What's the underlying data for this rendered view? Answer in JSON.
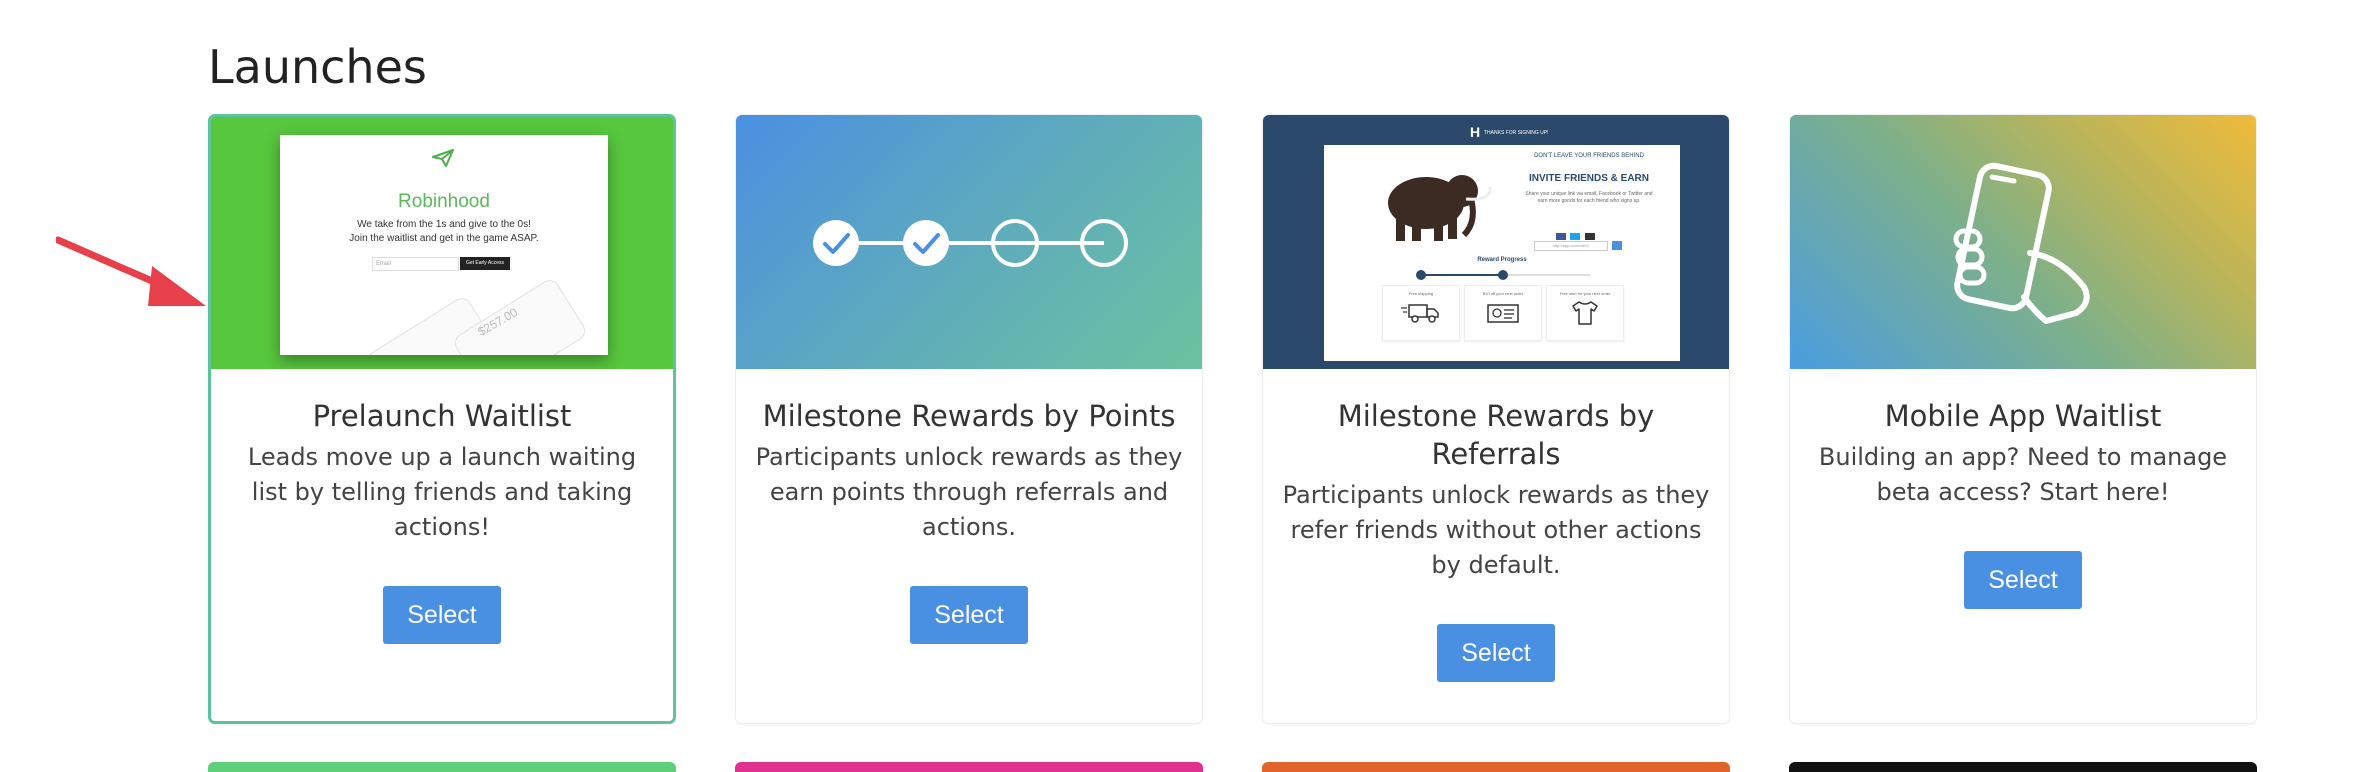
{
  "page": {
    "section_title": "Launches"
  },
  "cards": [
    {
      "title": "Prelaunch Waitlist",
      "description": "Leads move up a launch waiting list by telling friends and taking actions!",
      "button": "Select",
      "preview": {
        "brand": "Robinhood",
        "tagline_1": "We take from the 1s and give to the 0s!",
        "tagline_2": "Join the waitlist and get in the game ASAP.",
        "email_placeholder": "Email",
        "cta": "Get Early Access",
        "phone_amount": "$257.00"
      }
    },
    {
      "title": "Milestone Rewards by Points",
      "description": "Participants unlock rewards as they earn points through referrals and actions.",
      "button": "Select"
    },
    {
      "title": "Milestone Rewards by Referrals",
      "description": "Participants unlock rewards as they refer friends without other actions by default.",
      "button": "Select",
      "preview": {
        "logo": "H",
        "header_text": "THANKS FOR SIGNING UP!",
        "eyebrow": "DON'T LEAVE YOUR FRIENDS BEHIND",
        "heading": "INVITE FRIENDS & EARN",
        "body": "Share your unique link via email, Facebook or Twitter and earn more goods for each friend who signs up.",
        "link": "http://app.com/ref/12",
        "progress_label": "Reward Progress",
        "reward_1": "Free shipping",
        "reward_2": "$10 off your next order",
        "reward_3": "Free shirt for your next order"
      }
    },
    {
      "title": "Mobile App Waitlist",
      "description": "Building an app? Need to manage beta access? Start here!",
      "button": "Select"
    }
  ],
  "colors": {
    "accent": "#4a90e2",
    "selected_border": "#5cc39c",
    "waitlist_bg": "#57c73e",
    "referrals_bg": "#2b4a6b",
    "annotation_arrow": "#e8404a"
  }
}
